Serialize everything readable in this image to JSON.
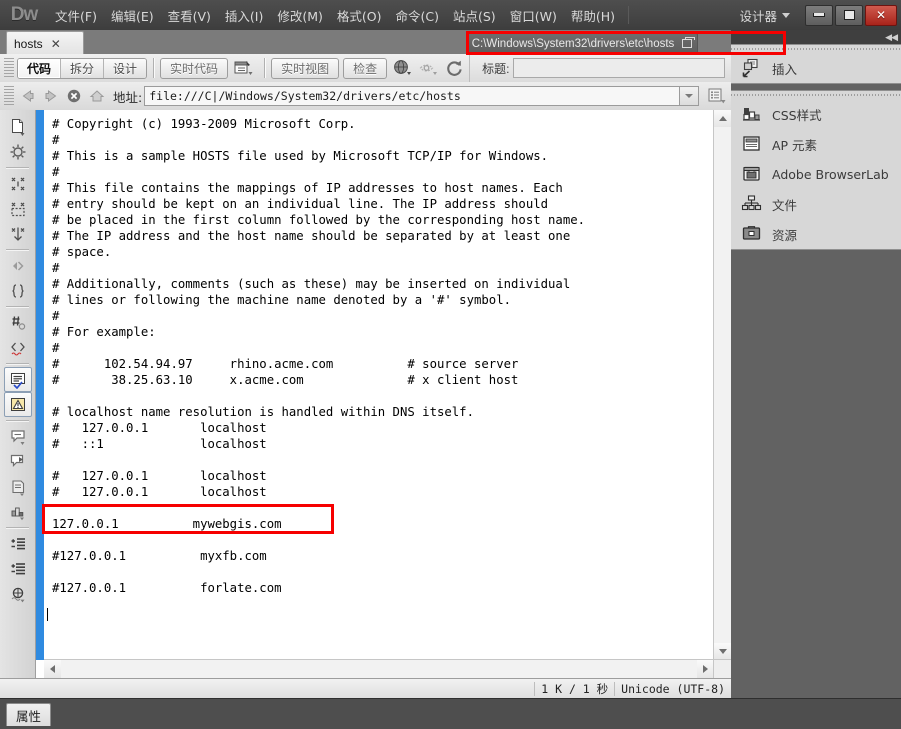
{
  "app": {
    "logo": "Dw",
    "workspace": "设计器"
  },
  "menu": {
    "items": [
      {
        "label": "文件(F)"
      },
      {
        "label": "编辑(E)"
      },
      {
        "label": "查看(V)"
      },
      {
        "label": "插入(I)"
      },
      {
        "label": "修改(M)"
      },
      {
        "label": "格式(O)"
      },
      {
        "label": "命令(C)"
      },
      {
        "label": "站点(S)"
      },
      {
        "label": "窗口(W)"
      },
      {
        "label": "帮助(H)"
      }
    ],
    "window_controls": {
      "minimize": "—",
      "maximize": "❐",
      "close": "✕"
    }
  },
  "document": {
    "tab_label": "hosts",
    "tab_close": "✕",
    "path": "C:\\Windows\\System32\\drivers\\etc\\hosts"
  },
  "viewbar": {
    "view_modes": [
      {
        "label": "代码",
        "active": true
      },
      {
        "label": "拆分",
        "active": false
      },
      {
        "label": "设计",
        "active": false
      }
    ],
    "live_code": "实时代码",
    "live_view": "实时视图",
    "inspect": "检查",
    "title_label": "标题:",
    "title_value": ""
  },
  "addressbar": {
    "label": "地址:",
    "value": "file:///C|/Windows/System32/drivers/etc/hosts",
    "placeholder": "file:///"
  },
  "code": {
    "text": "# Copyright (c) 1993-2009 Microsoft Corp.\n#\n# This is a sample HOSTS file used by Microsoft TCP/IP for Windows.\n#\n# This file contains the mappings of IP addresses to host names. Each\n# entry should be kept on an individual line. The IP address should\n# be placed in the first column followed by the corresponding host name.\n# The IP address and the host name should be separated by at least one\n# space.\n#\n# Additionally, comments (such as these) may be inserted on individual\n# lines or following the machine name denoted by a '#' symbol.\n#\n# For example:\n#\n#      102.54.94.97     rhino.acme.com          # source server\n#       38.25.63.10     x.acme.com              # x client host\n\n# localhost name resolution is handled within DNS itself.\n#   127.0.0.1       localhost\n#   ::1             localhost\n\n#   127.0.0.1       localhost\n#   127.0.0.1       localhost\n\n127.0.0.1          mywebgis.com\n\n#127.0.0.1          myxfb.com\n\n#127.0.0.1          forlate.com"
  },
  "statusbar": {
    "size_time": "1 K / 1 秒",
    "encoding": "Unicode (UTF-8)"
  },
  "properties": {
    "tab_label": "属性"
  },
  "right_panel": {
    "collapse_icon": "◀◀",
    "groups": [
      {
        "items": [
          {
            "label": "插入",
            "icon": "insert-icon"
          }
        ]
      },
      {
        "items": [
          {
            "label": "CSS样式",
            "icon": "css-styles-icon"
          },
          {
            "label": "AP 元素",
            "icon": "ap-elements-icon"
          },
          {
            "label": "Adobe BrowserLab",
            "icon": "browserlab-icon"
          },
          {
            "label": "文件",
            "icon": "files-icon"
          },
          {
            "label": "资源",
            "icon": "assets-icon"
          }
        ]
      }
    ]
  },
  "coding_toolbar": {
    "tools": [
      {
        "icon": "open-documents-icon"
      },
      {
        "icon": "collapse-full-tag-icon"
      },
      {
        "icon": "collapse-outside-icon"
      },
      {
        "icon": "expand-all-icon"
      },
      {
        "icon": "select-parent-tag-icon"
      },
      {
        "icon": "balance-braces-icon"
      },
      {
        "icon": "line-numbers-icon"
      },
      {
        "icon": "highlight-invalid-icon"
      },
      {
        "icon": "apply-comment-icon",
        "selected": true
      },
      {
        "icon": "remove-comment-icon",
        "selected": true
      },
      {
        "icon": "wrap-tag-icon"
      },
      {
        "icon": "recent-snippets-icon"
      },
      {
        "icon": "move-css-rules-icon"
      },
      {
        "icon": "indent-code-icon"
      },
      {
        "icon": "outdent-code-icon"
      },
      {
        "icon": "format-source-icon"
      }
    ]
  },
  "annotations": {
    "path_highlight": "C:\\Windows\\System32\\drivers\\etc\\hosts",
    "line_highlight": "127.0.0.1          mywebgis.com",
    "color": "#f60000"
  },
  "colors": {
    "accent_gutter": "#2f8ae0",
    "chrome_dark": "#4a4a4a",
    "panel_bg": "#626262",
    "annotation": "#f60000"
  }
}
